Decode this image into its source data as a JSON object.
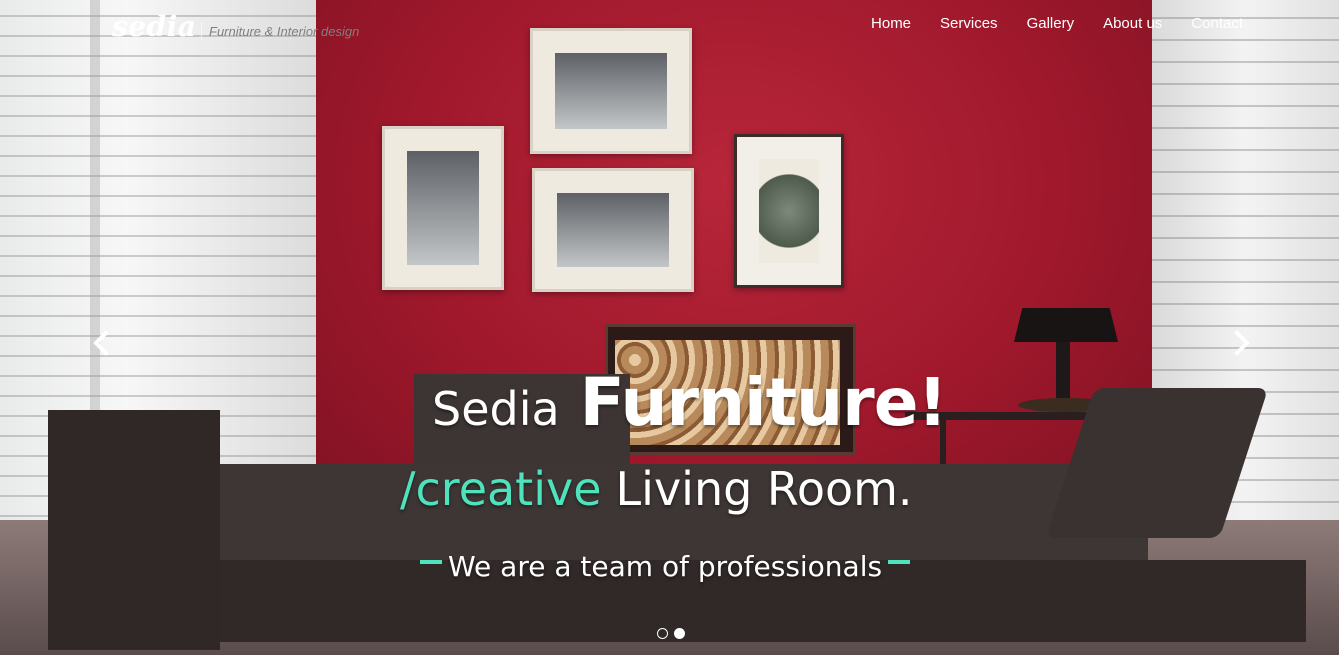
{
  "brand": {
    "logo": "sedia",
    "tagline": "Furniture & Interior design"
  },
  "nav": {
    "items": [
      "Home",
      "Services",
      "Gallery",
      "About us",
      "Contact"
    ]
  },
  "hero": {
    "line1_brand": "Sedia",
    "line1_product": "Furniture!",
    "line2_accent": "/creative",
    "line2_rest": "Living Room.",
    "subtitle": "We are a team of professionals"
  },
  "carousel": {
    "prev_icon": "chevron-left-icon",
    "next_icon": "chevron-right-icon",
    "slide_count": 2,
    "active_slide": 2
  },
  "colors": {
    "accent": "#4fe3bd",
    "wall": "#a0182c",
    "text": "#ffffff"
  }
}
